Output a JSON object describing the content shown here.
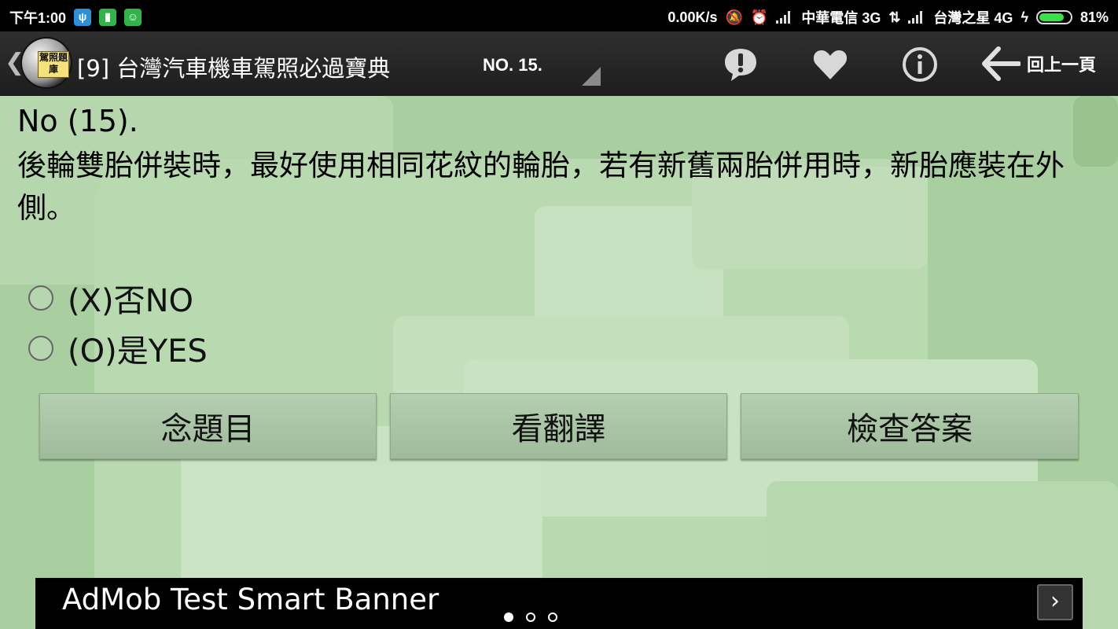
{
  "status_bar": {
    "time": "下午1:00",
    "net_speed": "0.00K/s",
    "carrier1": "中華電信 3G",
    "carrier2": "台灣之星 4G",
    "battery": "81%",
    "battery_level": 0.81
  },
  "action_bar": {
    "logo_text": "駕照題庫",
    "title": "[9] 台灣汽車機車駕照必過寶典",
    "question_number": "NO. 15.",
    "back_label": "回上一頁",
    "icons": [
      "report-icon",
      "heart-icon",
      "info-icon",
      "back-arrow-icon"
    ]
  },
  "question": {
    "number": "No (15).",
    "text": "後輪雙胎併裝時，最好使用相同花紋的輪胎，若有新舊兩胎併用時，新胎應裝在外側。",
    "options": [
      {
        "label": "(X)否NO",
        "selected": false
      },
      {
        "label": "(O)是YES",
        "selected": false
      }
    ]
  },
  "buttons": {
    "read_question": "念題目",
    "view_translation": "看翻譯",
    "check_answer": "檢查答案"
  },
  "ad": {
    "text": "AdMob Test Smart Banner",
    "arrow": "›",
    "page_count": 3,
    "active_page": 1
  },
  "colors": {
    "background": "#a9cfa0",
    "action_bar": "#262626",
    "button": "#a7c4a3",
    "battery_fill": "#3ee04a"
  }
}
